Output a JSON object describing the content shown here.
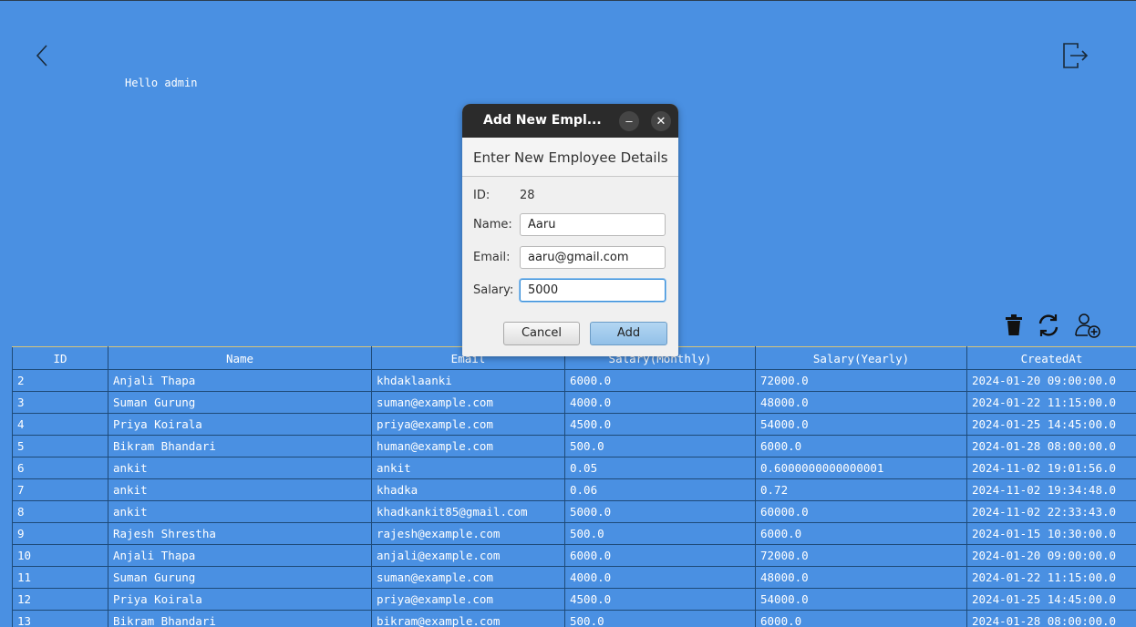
{
  "header": {
    "greeting": "Hello admin",
    "back_icon": "chevron-left-icon",
    "logout_icon": "logout-icon"
  },
  "toolbar": {
    "delete_icon": "trash-icon",
    "refresh_icon": "refresh-icon",
    "add_user_icon": "add-user-icon"
  },
  "table": {
    "columns": [
      "ID",
      "Name",
      "Email",
      "Salary(Monthly)",
      "Salary(Yearly)",
      "CreatedAt"
    ],
    "rows": [
      [
        "2",
        "Anjali Thapa",
        "khdaklaanki",
        "6000.0",
        "72000.0",
        "2024-01-20 09:00:00.0"
      ],
      [
        "3",
        "Suman Gurung",
        "suman@example.com",
        "4000.0",
        "48000.0",
        "2024-01-22 11:15:00.0"
      ],
      [
        "4",
        "Priya Koirala",
        "priya@example.com",
        "4500.0",
        "54000.0",
        "2024-01-25 14:45:00.0"
      ],
      [
        "5",
        "Bikram Bhandari",
        "human@example.com",
        "500.0",
        "6000.0",
        "2024-01-28 08:00:00.0"
      ],
      [
        "6",
        "ankit",
        "ankit",
        "0.05",
        "0.6000000000000001",
        "2024-11-02 19:01:56.0"
      ],
      [
        "7",
        "ankit",
        "khadka",
        "0.06",
        "0.72",
        "2024-11-02 19:34:48.0"
      ],
      [
        "8",
        "ankit",
        "khadkankit85@gmail.com",
        "5000.0",
        "60000.0",
        "2024-11-02 22:33:43.0"
      ],
      [
        "9",
        "Rajesh Shrestha",
        "rajesh@example.com",
        "500.0",
        "6000.0",
        "2024-01-15 10:30:00.0"
      ],
      [
        "10",
        "Anjali Thapa",
        "anjali@example.com",
        "6000.0",
        "72000.0",
        "2024-01-20 09:00:00.0"
      ],
      [
        "11",
        "Suman Gurung",
        "suman@example.com",
        "4000.0",
        "48000.0",
        "2024-01-22 11:15:00.0"
      ],
      [
        "12",
        "Priya Koirala",
        "priya@example.com",
        "4500.0",
        "54000.0",
        "2024-01-25 14:45:00.0"
      ],
      [
        "13",
        "Bikram Bhandari",
        "bikram@example.com",
        "500.0",
        "6000.0",
        "2024-01-28 08:00:00.0"
      ]
    ]
  },
  "dialog": {
    "title": "Add New Empl...",
    "minimize_label": "–",
    "close_label": "✕",
    "header": "Enter New Employee Details",
    "id_label": "ID:",
    "id_value": "28",
    "name_label": "Name:",
    "name_value": "Aaru",
    "email_label": "Email:",
    "email_value": "aaru@gmail.com",
    "salary_label": "Salary:",
    "salary_value": "5000",
    "cancel_label": "Cancel",
    "add_label": "Add"
  }
}
